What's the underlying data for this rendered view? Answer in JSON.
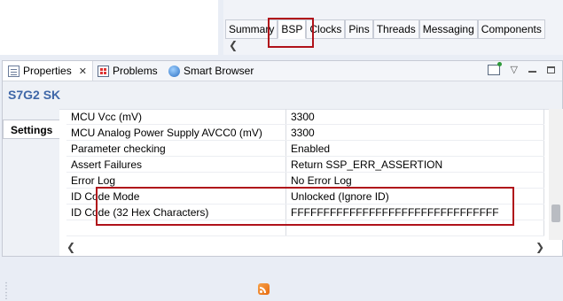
{
  "editor": {
    "tabs": [
      {
        "label": "Summary"
      },
      {
        "label": "BSP"
      },
      {
        "label": "Clocks"
      },
      {
        "label": "Pins"
      },
      {
        "label": "Threads"
      },
      {
        "label": "Messaging"
      },
      {
        "label": "Components"
      }
    ],
    "active_tab": "BSP"
  },
  "view": {
    "tabs": [
      {
        "label": "Properties",
        "icon": "properties-icon"
      },
      {
        "label": "Problems",
        "icon": "problems-icon"
      },
      {
        "label": "Smart Browser",
        "icon": "globe-icon"
      }
    ],
    "header_title": "S7G2 SK",
    "side_tab": "Settings",
    "rows": [
      {
        "name": "MCU Vcc (mV)",
        "value": "3300"
      },
      {
        "name": "MCU Analog Power Supply AVCC0 (mV)",
        "value": "3300"
      },
      {
        "name": "Parameter checking",
        "value": "Enabled"
      },
      {
        "name": "Assert Failures",
        "value": "Return SSP_ERR_ASSERTION"
      },
      {
        "name": "Error Log",
        "value": "No Error Log"
      },
      {
        "name": "ID Code Mode",
        "value": "Unlocked (Ignore ID)"
      },
      {
        "name": "ID Code (32 Hex Characters)",
        "value": "FFFFFFFFFFFFFFFFFFFFFFFFFFFFFFFF"
      },
      {
        "name": "",
        "value": ""
      }
    ]
  },
  "colors": {
    "highlight_box": "#b0121a",
    "header_title": "#3f67a8"
  }
}
